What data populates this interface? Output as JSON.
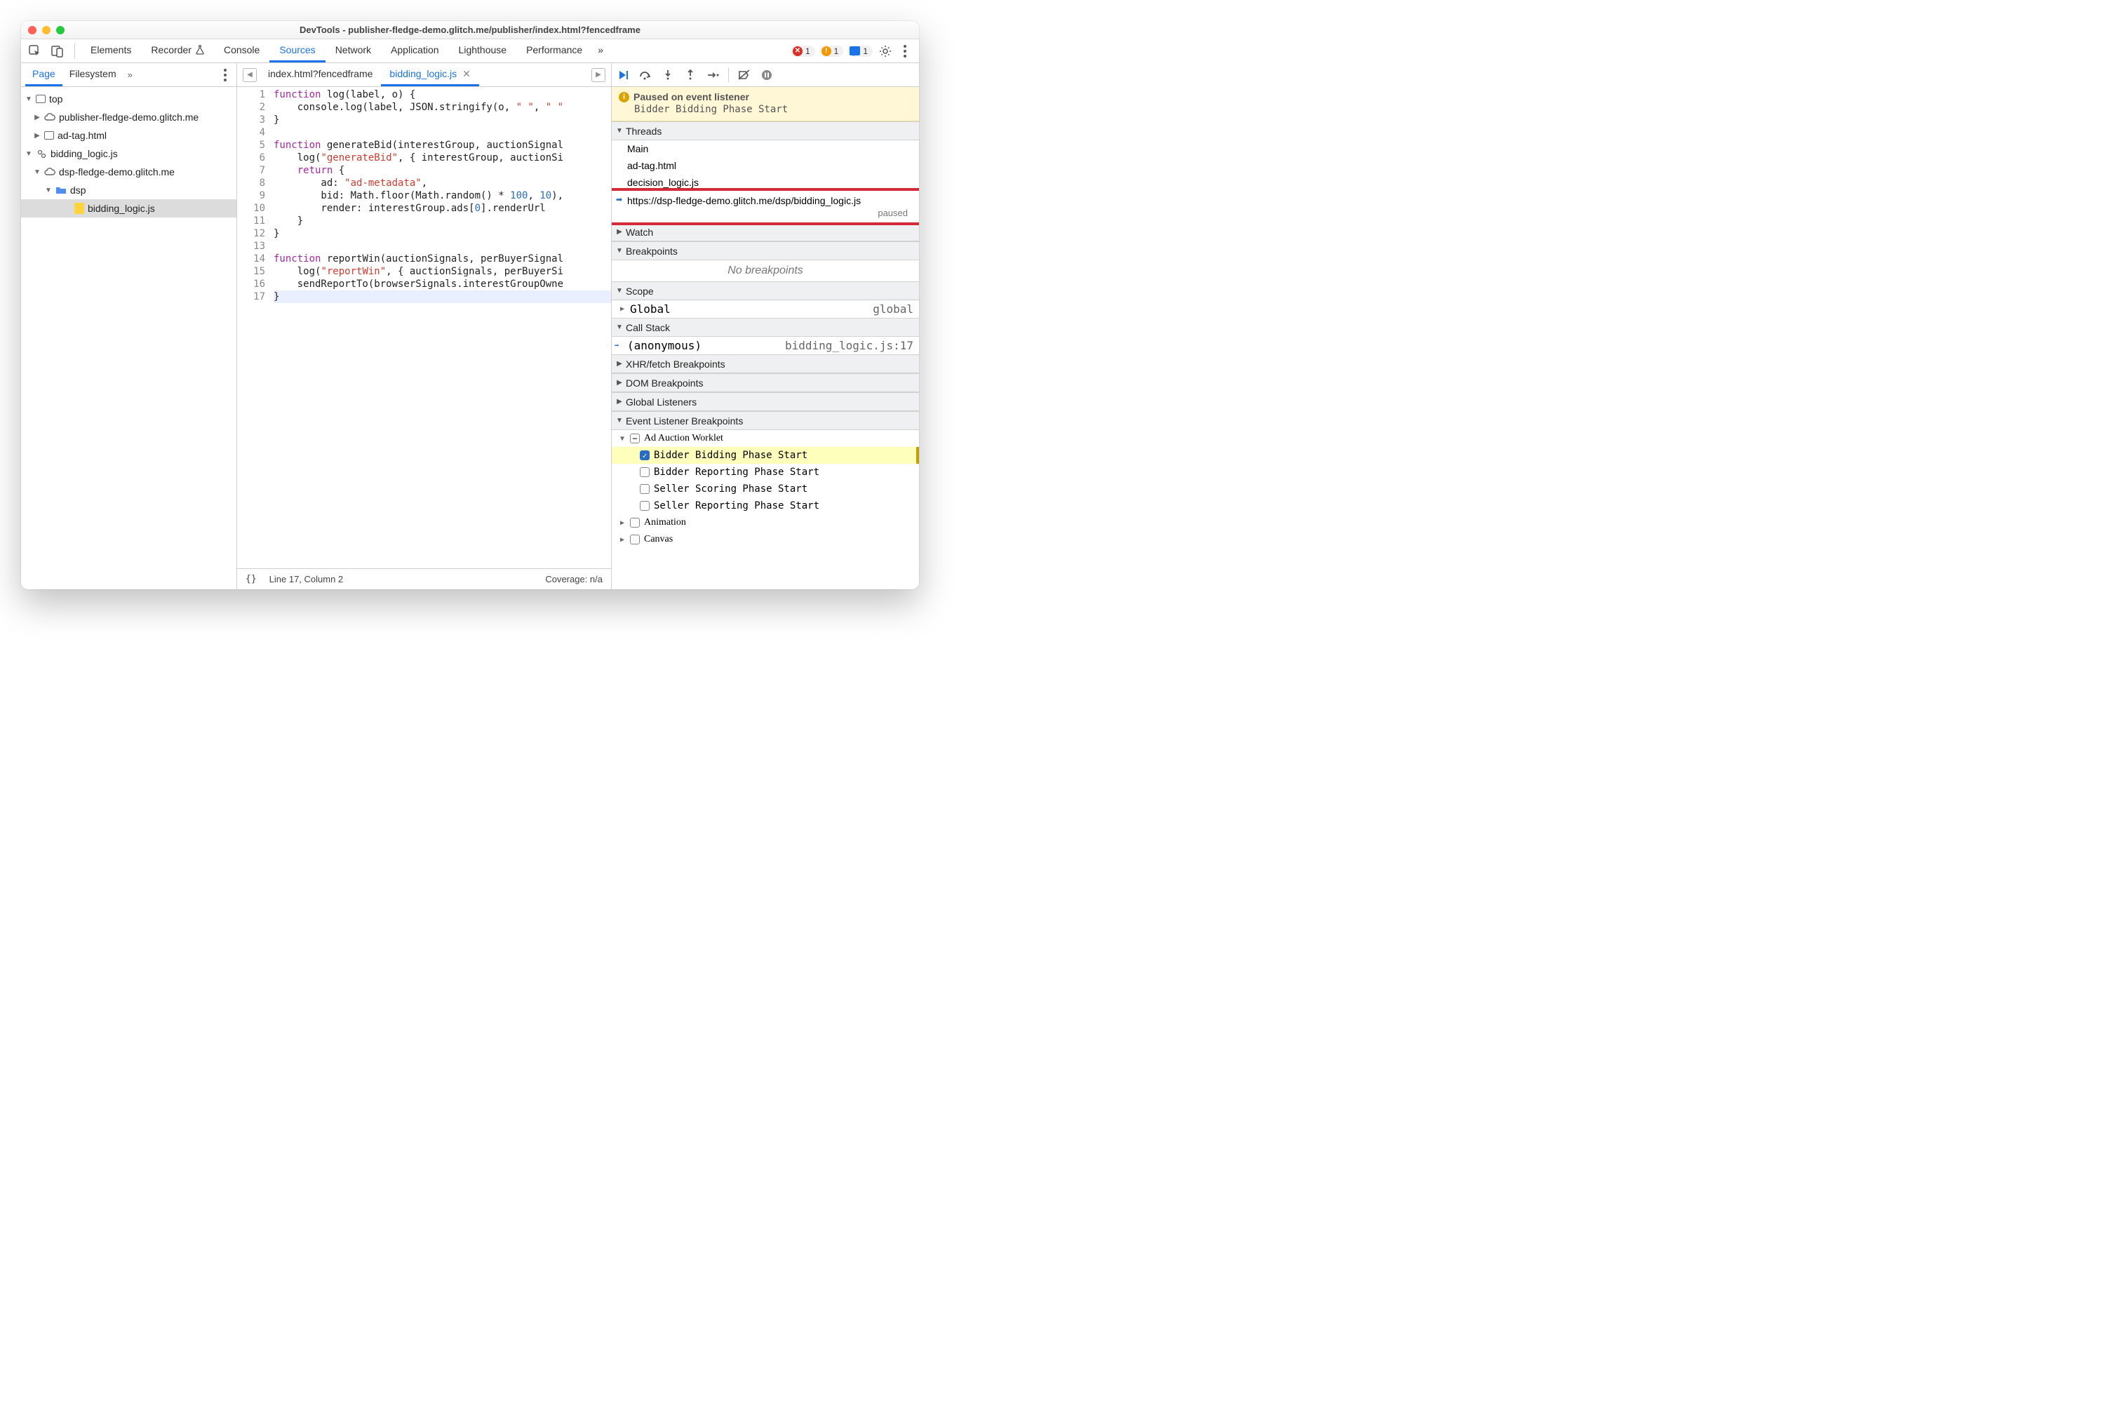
{
  "titlebar": {
    "title": "DevTools - publisher-fledge-demo.glitch.me/publisher/index.html?fencedframe"
  },
  "toolbar": {
    "tabs": [
      "Elements",
      "Recorder",
      "Console",
      "Sources",
      "Network",
      "Application",
      "Lighthouse",
      "Performance"
    ],
    "active": "Sources",
    "more": "»",
    "errors": "1",
    "warnings": "1",
    "messages": "1"
  },
  "left": {
    "tabs": [
      "Page",
      "Filesystem"
    ],
    "active": "Page",
    "more": "»",
    "tree": {
      "top": "top",
      "domain1": "publisher-fledge-demo.glitch.me",
      "adtag": "ad-tag.html",
      "biddingworklet": "bidding_logic.js",
      "domain2": "dsp-fledge-demo.glitch.me",
      "dsp": "dsp",
      "biddingfile": "bidding_logic.js"
    }
  },
  "files": {
    "tabs": [
      {
        "name": "index.html?fencedframe",
        "active": false,
        "closable": false
      },
      {
        "name": "bidding_logic.js",
        "active": true,
        "closable": true
      }
    ]
  },
  "code": {
    "lines": 17,
    "l1a": "function",
    "l1b": " log(label, o) {",
    "l2a": "    console.log(label, JSON.stringify(o, ",
    "l2b": "\" \"",
    "l2c": ", ",
    "l2d": "\" \"",
    "l3": "}",
    "l4": "",
    "l5a": "function",
    "l5b": " generateBid(interestGroup, auctionSignal",
    "l6a": "    log(",
    "l6b": "\"generateBid\"",
    "l6c": ", { interestGroup, auctionSi",
    "l7a": "    ",
    "l7b": "return",
    "l7c": " {",
    "l8a": "        ad: ",
    "l8b": "\"ad-metadata\"",
    "l8c": ",",
    "l9a": "        bid: Math.floor(Math.random() * ",
    "l9b": "100",
    "l9c": ", ",
    "l9d": "10",
    "l9e": "),",
    "l10a": "        render: interestGroup.ads[",
    "l10b": "0",
    "l10c": "].renderUrl",
    "l11": "    }",
    "l12": "}",
    "l13": "",
    "l14a": "function",
    "l14b": " reportWin(auctionSignals, perBuyerSignal",
    "l15a": "    log(",
    "l15b": "\"reportWin\"",
    "l15c": ", { auctionSignals, perBuyerSi",
    "l16": "    sendReportTo(browserSignals.interestGroupOwne",
    "l17": "}"
  },
  "status": {
    "pretty": "{}",
    "pos": "Line 17, Column 2",
    "coverage": "Coverage: n/a"
  },
  "debugger": {
    "pause": {
      "title": "Paused on event listener",
      "detail": "Bidder Bidding Phase Start"
    },
    "threads": {
      "label": "Threads",
      "items": [
        "Main",
        "ad-tag.html",
        "decision_logic.js"
      ],
      "current": "https://dsp-fledge-demo.glitch.me/dsp/bidding_logic.js",
      "status": "paused"
    },
    "watch": "Watch",
    "breakpoints": {
      "label": "Breakpoints",
      "empty": "No breakpoints"
    },
    "scope": {
      "label": "Scope",
      "global": "Global",
      "globalr": "global"
    },
    "callstack": {
      "label": "Call Stack",
      "fn": "(anonymous)",
      "loc": "bidding_logic.js:17"
    },
    "xhr": "XHR/fetch Breakpoints",
    "dom": "DOM Breakpoints",
    "globlis": "Global Listeners",
    "elb": {
      "label": "Event Listener Breakpoints",
      "group": "Ad Auction Worklet",
      "items": [
        {
          "label": "Bidder Bidding Phase Start",
          "checked": true
        },
        {
          "label": "Bidder Reporting Phase Start",
          "checked": false
        },
        {
          "label": "Seller Scoring Phase Start",
          "checked": false
        },
        {
          "label": "Seller Reporting Phase Start",
          "checked": false
        }
      ],
      "anim": "Animation",
      "canvas": "Canvas"
    }
  }
}
